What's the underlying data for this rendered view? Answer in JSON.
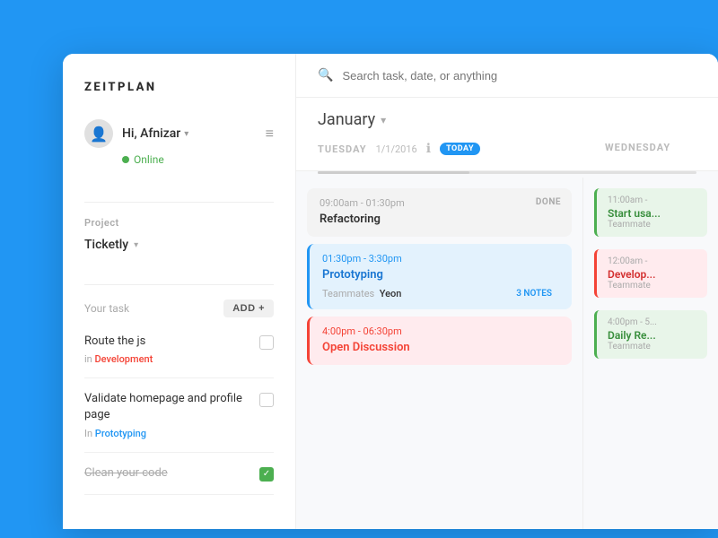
{
  "app": {
    "name": "ZEITPLAN",
    "background_color": "#2196F3"
  },
  "sidebar": {
    "user": {
      "name": "Hi, Afnizar",
      "status": "Online",
      "avatar_icon": "👤"
    },
    "project_label": "Project",
    "project_name": "Ticketly",
    "task_label": "Your task",
    "add_button": "ADD +",
    "tasks": [
      {
        "title": "Route the js",
        "category_prefix": "in",
        "category": "Development",
        "category_class": "cat-dev",
        "completed": false
      },
      {
        "title": "Validate homepage and profile page",
        "category_prefix": "In",
        "category": "Prototyping",
        "category_class": "cat-proto",
        "completed": false
      },
      {
        "title": "Clean your code",
        "category_prefix": "",
        "category": "",
        "category_class": "",
        "completed": true
      }
    ]
  },
  "calendar": {
    "search_placeholder": "Search task, date, or anything",
    "month": "January",
    "days": [
      {
        "name": "TUESDAY",
        "date": "1/1/2016",
        "is_today": true,
        "today_label": "TODAY"
      },
      {
        "name": "WEDNESDAY",
        "date": "",
        "is_today": false,
        "today_label": ""
      }
    ],
    "tuesday_events": [
      {
        "type": "gray",
        "time": "09:00am - 01:30pm",
        "title": "Refactoring",
        "done": "DONE",
        "has_teammates": false
      },
      {
        "type": "blue",
        "time": "01:30pm - 3:30pm",
        "title": "Prototyping",
        "done": "",
        "has_teammates": true,
        "teammate": "Yeon",
        "notes": "3 NOTES"
      },
      {
        "type": "red",
        "time": "4:00pm - 06:30pm",
        "title": "Open Discussion",
        "done": "",
        "has_teammates": false
      }
    ],
    "wednesday_events": [
      {
        "type": "green",
        "time": "11:00am -",
        "title": "Start usa...",
        "sub": "Teammate"
      },
      {
        "type": "red",
        "time": "12:00am -",
        "title": "Develop...",
        "sub": "Teammate"
      },
      {
        "type": "green2",
        "time": "4:00pm - 5...",
        "title": "Daily Re...",
        "sub": "Teammate"
      }
    ]
  }
}
